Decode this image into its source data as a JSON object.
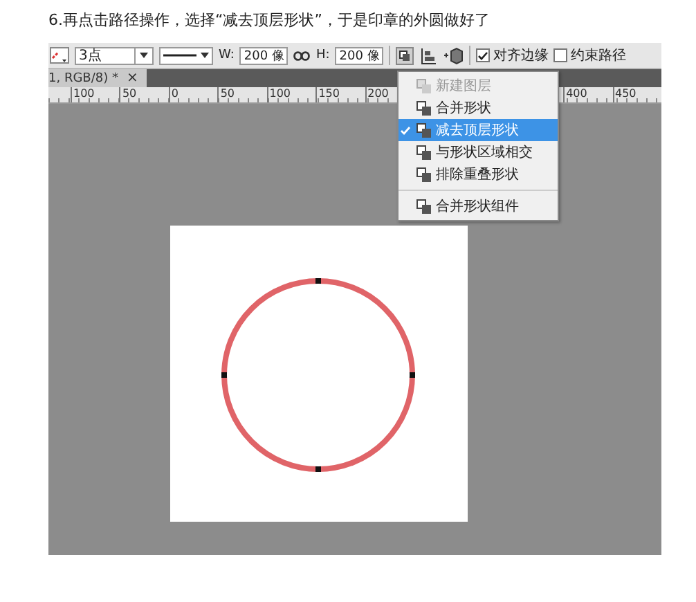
{
  "instruction": "6.再点击路径操作，选择“减去顶层形状”，于是印章的外圆做好了",
  "toolbar": {
    "stroke_width": "3点",
    "width_label": "W:",
    "width_value": "200 像",
    "height_label": "H:",
    "height_value": "200 像",
    "checkboxes": [
      {
        "label": "对齐边缘",
        "checked": true
      },
      {
        "label": "约束路径",
        "checked": false
      }
    ]
  },
  "document_tab": {
    "title": "1, RGB/8) *",
    "close": "×"
  },
  "ruler": {
    "labels": [
      "100",
      "50",
      "0",
      "50",
      "100",
      "150",
      "200",
      "400",
      "450"
    ]
  },
  "path_menu": {
    "sections": [
      {
        "items": [
          {
            "label": "新建图层",
            "disabled": true,
            "selected": false
          },
          {
            "label": "合并形状",
            "disabled": false,
            "selected": false
          },
          {
            "label": "减去顶层形状",
            "disabled": false,
            "selected": true
          },
          {
            "label": "与形状区域相交",
            "disabled": false,
            "selected": false
          },
          {
            "label": "排除重叠形状",
            "disabled": false,
            "selected": false
          }
        ]
      },
      {
        "items": [
          {
            "label": "合并形状组件",
            "disabled": false,
            "selected": false
          }
        ]
      }
    ]
  }
}
